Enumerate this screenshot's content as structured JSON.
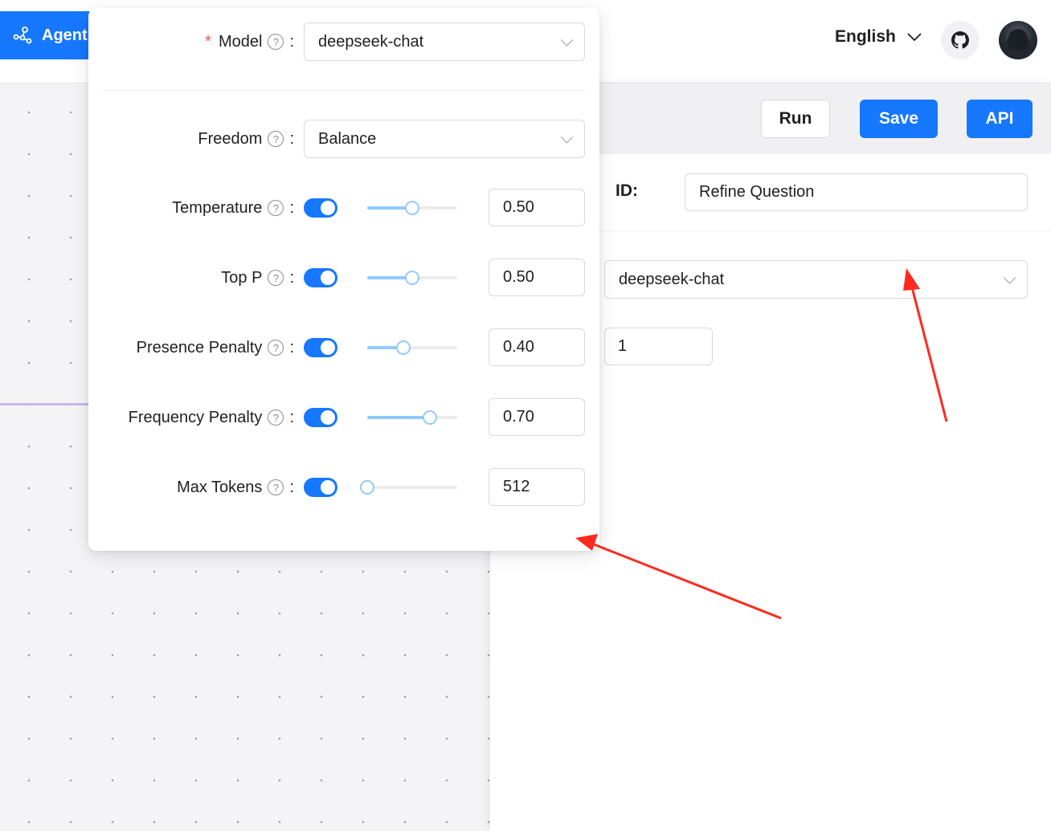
{
  "header": {
    "agent_tab_label": "Agent",
    "language": "English"
  },
  "toolbar": {
    "run_label": "Run",
    "save_label": "Save",
    "api_label": "API"
  },
  "drawer": {
    "id_label": "ID:",
    "id_value": "Refine Question",
    "model_value": "deepseek-chat",
    "count_value": "1"
  },
  "popover": {
    "model": {
      "label": "Model",
      "required_mark": "*",
      "value": "deepseek-chat"
    },
    "freedom": {
      "label": "Freedom",
      "value": "Balance"
    },
    "params": [
      {
        "label": "Temperature",
        "enabled": true,
        "value": "0.50",
        "slider_fraction": 0.5
      },
      {
        "label": "Top P",
        "enabled": true,
        "value": "0.50",
        "slider_fraction": 0.5
      },
      {
        "label": "Presence Penalty",
        "enabled": true,
        "value": "0.40",
        "slider_fraction": 0.4
      },
      {
        "label": "Frequency Penalty",
        "enabled": true,
        "value": "0.70",
        "slider_fraction": 0.7
      },
      {
        "label": "Max Tokens",
        "enabled": true,
        "value": "512",
        "slider_fraction": 0.0
      }
    ],
    "help_glyph": "?",
    "colon": ":"
  },
  "colors": {
    "accent": "#1677ff",
    "slider_fill": "#91caff",
    "annotation": "#ff2a1f",
    "canvas_edge": "#c6b8f0"
  },
  "icons": {
    "agent_tab": "graph-nodes-icon",
    "language_dropdown": "chevron-down-icon",
    "github": "github-icon",
    "help": "question-circle-icon"
  }
}
